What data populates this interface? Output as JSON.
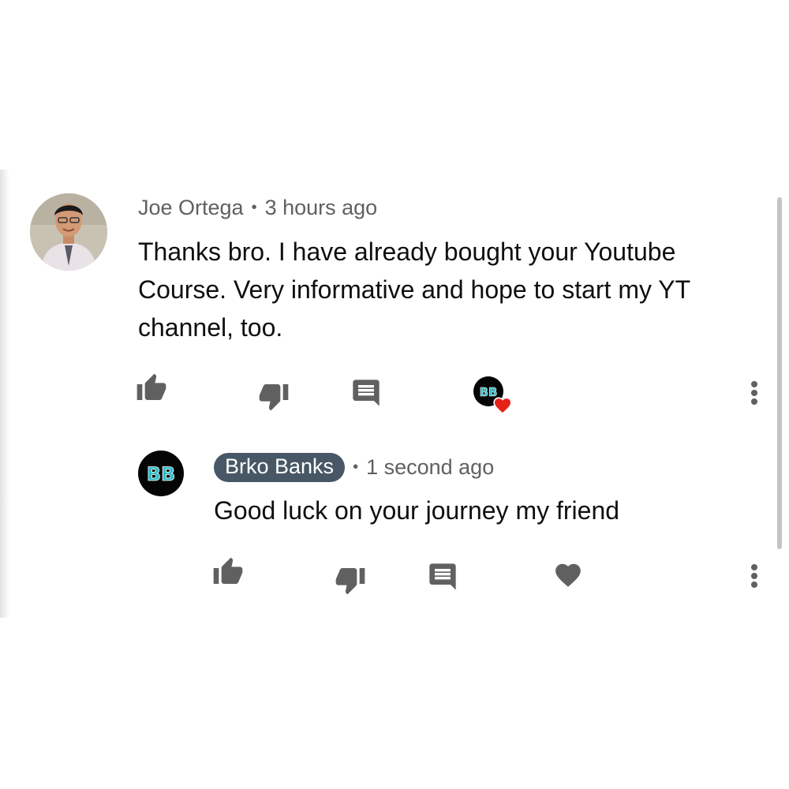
{
  "comment": {
    "author": "Joe Ortega",
    "time": "3 hours ago",
    "text": "Thanks bro. I have already bought your Youtube Course. Very informative and hope to start my YT channel, too.",
    "icons": [
      "thumbs-up-icon",
      "thumbs-down-icon",
      "reply-icon",
      "creator-heart-icon",
      "more-vert-icon"
    ]
  },
  "reply": {
    "author": "Brko Banks",
    "time": "1 second ago",
    "text": "Good luck on your journey my friend",
    "icons": [
      "thumbs-up-icon",
      "thumbs-down-icon",
      "reply-icon",
      "heart-icon",
      "more-vert-icon"
    ]
  },
  "avatar_initials": "BB",
  "colors": {
    "icon_gray": "#606060",
    "heart_red": "#e62117",
    "chip_bg": "#485766",
    "teal": "#2bbcc6"
  }
}
